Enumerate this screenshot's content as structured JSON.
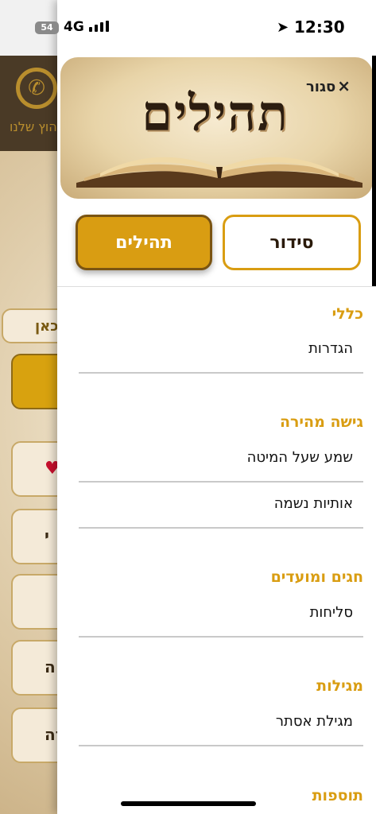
{
  "status_bar": {
    "battery": "54",
    "network": "4G",
    "time": "12:30",
    "location_icon": "location-arrow-icon"
  },
  "background": {
    "whatsapp_label": "הוץ שלנו",
    "pill_label": "כאן",
    "buttons": [
      "",
      "",
      "י",
      "",
      "ה",
      "רה"
    ]
  },
  "drawer": {
    "close_label": "סגור",
    "logo_text": "תהילים",
    "segments": {
      "siddur": "סידור",
      "tehilim": "תהילים"
    },
    "sections": [
      {
        "title": "כללי",
        "items": [
          "הגדרות"
        ]
      },
      {
        "title": "גישה מהירה",
        "items": [
          "שמע שעל המיטה",
          "אותיות נשמה"
        ]
      },
      {
        "title": "חגים ומועדים",
        "items": [
          "סליחות"
        ]
      },
      {
        "title": "מגילות",
        "items": [
          "מגילת אסתר"
        ]
      },
      {
        "title": "תוספות",
        "items": []
      }
    ]
  },
  "colors": {
    "accent": "#d99d12",
    "header_dark": "#4a3a26"
  }
}
